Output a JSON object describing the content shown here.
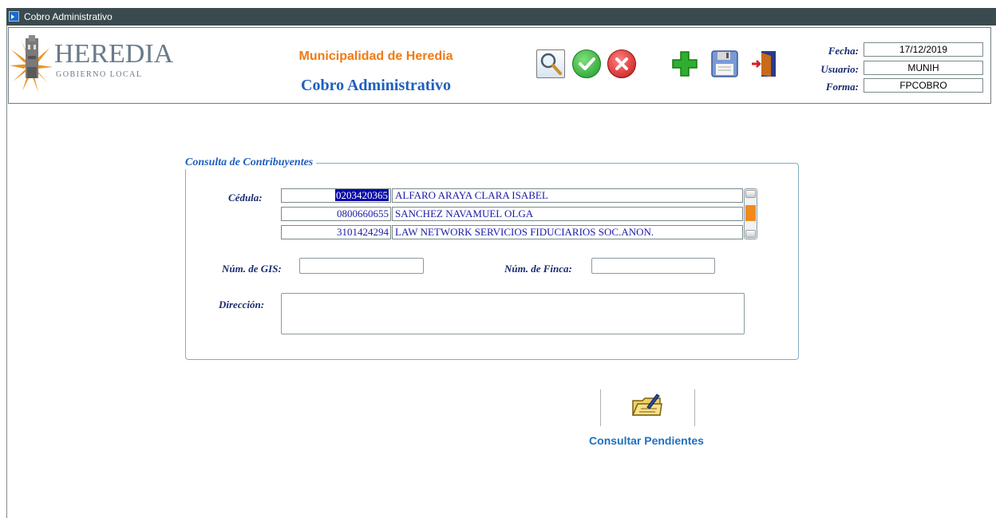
{
  "window": {
    "title": "Cobro Administrativo"
  },
  "header": {
    "logo_title": "HEREDIA",
    "logo_subtitle": "GOBIERNO LOCAL",
    "institution": "Municipalidad de Heredia",
    "form_title": "Cobro Administrativo"
  },
  "toolbar": {
    "buttons": [
      {
        "name": "search",
        "icon": "magnifier-icon"
      },
      {
        "name": "accept",
        "icon": "check-icon",
        "color": "#2ca02c"
      },
      {
        "name": "cancel",
        "icon": "cancel-icon",
        "color": "#d62020"
      },
      {
        "name": "add",
        "icon": "plus-icon",
        "color": "#22a022"
      },
      {
        "name": "save",
        "icon": "floppy-icon"
      },
      {
        "name": "exit",
        "icon": "exit-door-icon"
      }
    ]
  },
  "info": {
    "fecha_label": "Fecha:",
    "fecha_value": "17/12/2019",
    "usuario_label": "Usuario:",
    "usuario_value": "MUNIH",
    "forma_label": "Forma:",
    "forma_value": "FPCOBRO"
  },
  "consulta": {
    "title": "Consulta de Contribuyentes",
    "cedula_label": "Cédula:",
    "rows": [
      {
        "cedula": "0203420365",
        "nombre": "ALFARO ARAYA CLARA ISABEL",
        "selected": true
      },
      {
        "cedula": "0800660655",
        "nombre": "SANCHEZ NAVAMUEL OLGA",
        "selected": false
      },
      {
        "cedula": "3101424294",
        "nombre": "LAW NETWORK SERVICIOS FIDUCIARIOS SOC.ANON.",
        "selected": false
      }
    ],
    "gis_label": "Núm. de GIS:",
    "gis_value": "",
    "finca_label": "Núm. de Finca:",
    "finca_value": "",
    "direccion_label": "Dirección:",
    "direccion_value": ""
  },
  "actions": {
    "consultar_label": "Consultar Pendientes"
  },
  "colors": {
    "accent_orange": "#f07a10",
    "accent_blue": "#1f5fbf",
    "selection": "#0a0aa8"
  }
}
